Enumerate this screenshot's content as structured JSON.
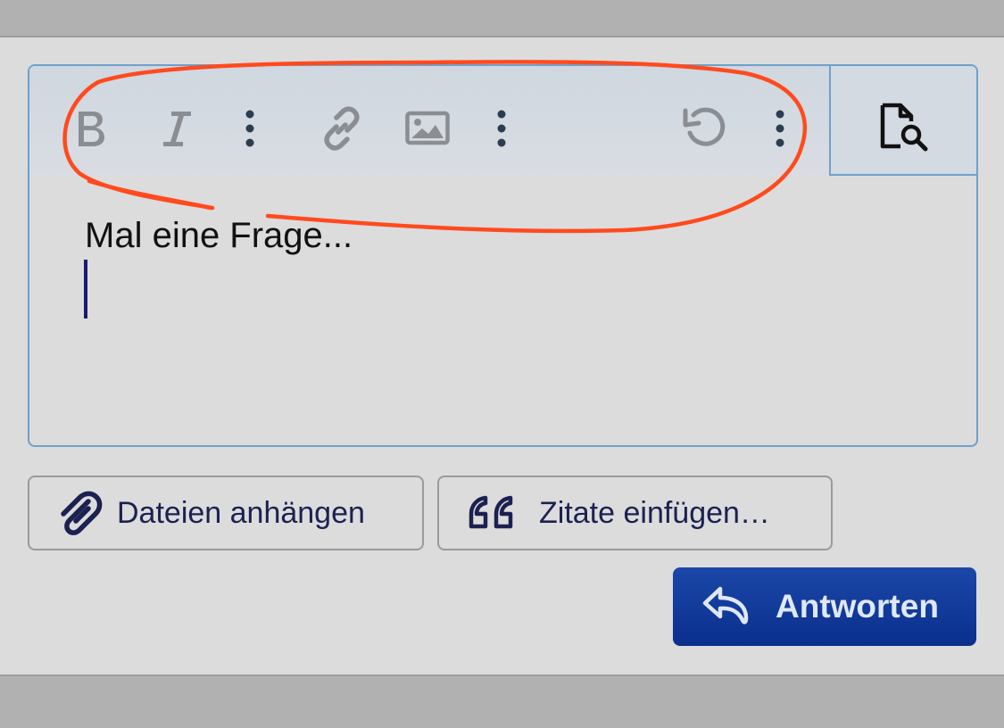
{
  "editor": {
    "content_text": "Mal eine Frage...",
    "toolbar_icons": [
      "bold-icon",
      "italic-icon",
      "more-vertical-icon",
      "link-icon",
      "image-icon",
      "more-vertical-icon",
      "undo-icon",
      "more-vertical-icon"
    ],
    "preview_icon": "document-search-icon"
  },
  "actions": {
    "attach_label": "Dateien anhängen",
    "quote_label": "Zitate einfügen…",
    "reply_label": "Antworten"
  },
  "colors": {
    "accent": "#0a2f8d",
    "border": "#6fa0cc",
    "annotation": "#ff4a1e"
  }
}
